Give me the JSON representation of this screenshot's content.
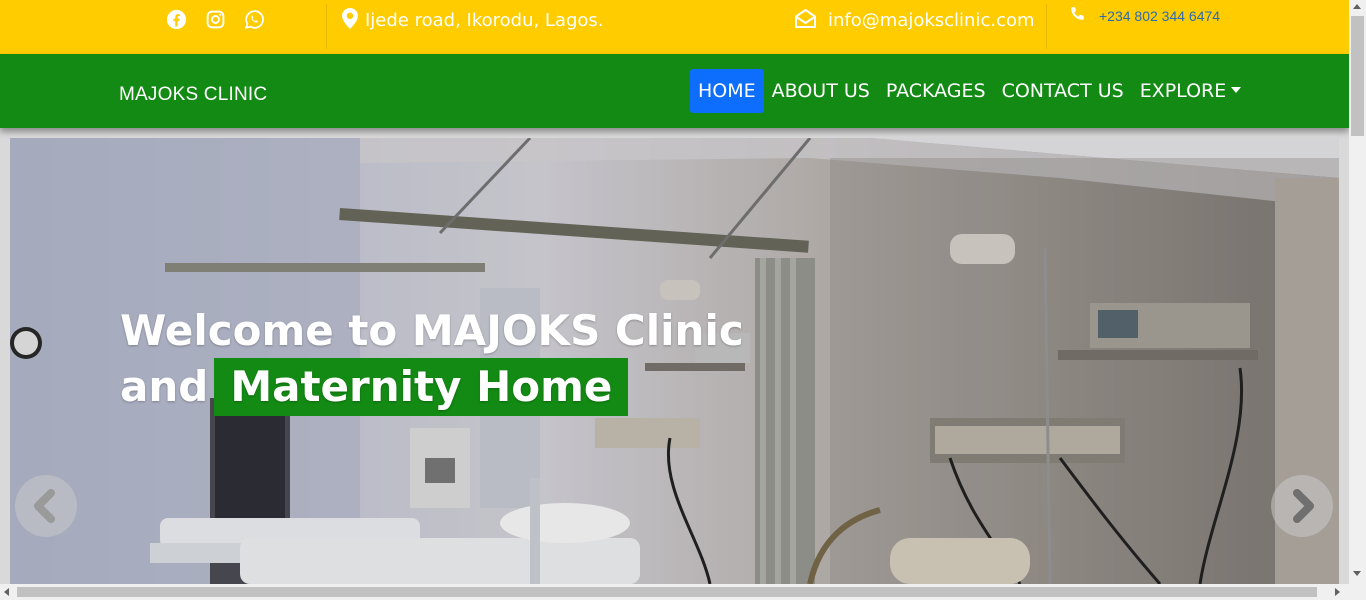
{
  "topbar": {
    "social_icons": [
      "facebook-icon",
      "instagram-icon",
      "whatsapp-icon"
    ],
    "address": "Ijede road, Ikorodu, Lagos.",
    "email": "info@majoksclinic.com",
    "phone": "+234 802 344 6474",
    "background": "#ffcc00"
  },
  "navbar": {
    "brand": "MAJOKS CLINIC",
    "items": [
      {
        "label": "HOME",
        "active": true
      },
      {
        "label": "ABOUT US"
      },
      {
        "label": "PACKAGES"
      },
      {
        "label": "CONTACT US"
      },
      {
        "label": "EXPLORE"
      }
    ],
    "background": "#138a14",
    "active_color": "#0d6efd"
  },
  "hero": {
    "line1": "Welcome to MAJOKS Clinic",
    "line2_prefix": "and",
    "line2_highlight": "Maternity Home",
    "prev_icon": "chevron-left-icon",
    "next_icon": "chevron-right-icon"
  }
}
